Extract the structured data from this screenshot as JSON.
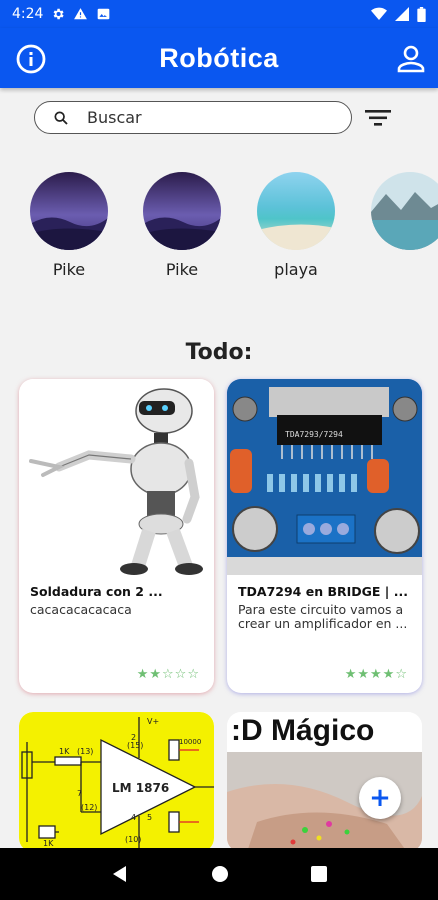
{
  "status_bar": {
    "time": "4:24",
    "icons_left": [
      "gear-icon",
      "warning-icon",
      "image-icon"
    ],
    "icons_right": [
      "wifi-icon",
      "signal-icon",
      "battery-icon"
    ]
  },
  "app_bar": {
    "title": "Robótica",
    "left_icon": "info-icon",
    "right_icon": "account-icon",
    "color": "#0a57f0"
  },
  "search": {
    "placeholder": "Buscar",
    "icon": "search-icon",
    "filter_icon": "filter-icon"
  },
  "stories": [
    {
      "label": "Pike"
    },
    {
      "label": "Pike"
    },
    {
      "label": "playa"
    },
    {
      "label": ""
    }
  ],
  "section": {
    "title": "Todo:"
  },
  "cards": [
    {
      "title": "Soldadura con 2 ...",
      "description": "cacacacacacaca",
      "rating": 2,
      "max_rating": 5,
      "stars": "★★☆☆☆"
    },
    {
      "title": "TDA7294 en BRIDGE | ...",
      "description": "Para este circuito vamos a crear un amplificador en ...",
      "rating": 4,
      "max_rating": 5,
      "stars": "★★★★☆"
    },
    {
      "title": "",
      "description": "",
      "image_text": [
        "LM 1876",
        "1K",
        "1K",
        "V+",
        "(13)",
        "(15)",
        "(12)",
        "7",
        "2",
        "4",
        "5",
        "(10)",
        "10000"
      ]
    },
    {
      "title": "",
      "description": "",
      "image_text": ":D Mágico"
    }
  ],
  "fab": {
    "label": "+"
  },
  "nav_bar": {
    "icons": [
      "back-icon",
      "home-icon",
      "recents-icon"
    ]
  }
}
